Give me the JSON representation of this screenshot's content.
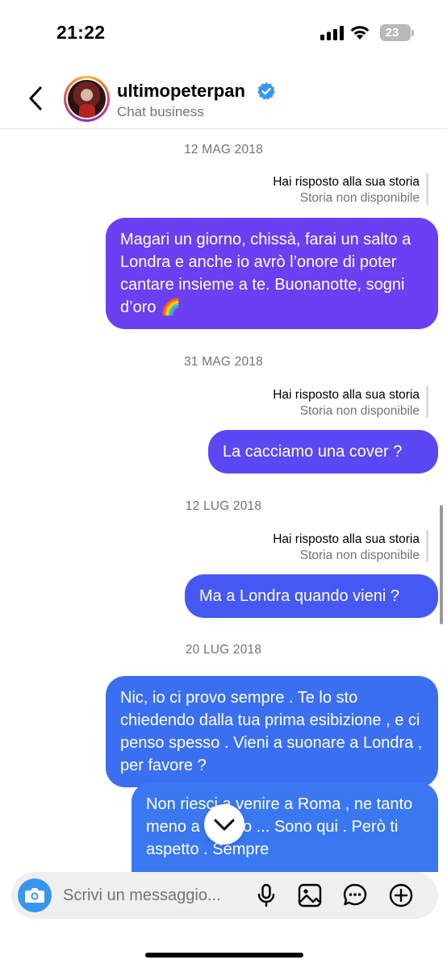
{
  "status_bar": {
    "time": "21:22",
    "battery": "23"
  },
  "header": {
    "username": "ultimopeterpan",
    "subtitle": "Chat business"
  },
  "conversation": {
    "sections": [
      {
        "date": "12 MAG 2018",
        "reply_title": "Hai risposto alla sua storia",
        "reply_status": "Storia non disponibile",
        "messages": [
          "Magari un giorno, chissà, farai un salto a Londra e anche io avrò l’onore di poter cantare insieme a te. Buonanotte, sogni d’oro 🌈"
        ]
      },
      {
        "date": "31 MAG 2018",
        "reply_title": "Hai risposto alla sua storia",
        "reply_status": "Storia non disponibile",
        "messages": [
          "La cacciamo una cover ?"
        ]
      },
      {
        "date": "12 LUG 2018",
        "reply_title": "Hai risposto alla sua storia",
        "reply_status": "Storia non disponibile",
        "messages": [
          "Ma a Londra quando vieni ?"
        ]
      },
      {
        "date": "20 LUG 2018",
        "messages": [
          "Nic, io ci provo sempre . Te lo sto chiedendo dalla tua prima esibizione , e ci penso spesso . Vieni a suonare a Londra , per favore ?",
          "Non riesci a venire a Roma , ne tanto meno a Milano ... Sono qui . Però ti aspetto . Sempre"
        ]
      }
    ]
  },
  "composer": {
    "placeholder": "Scrivi un messaggio..."
  },
  "colors": {
    "bubble_1": "#6b3ff2",
    "bubble_2": "#5a48f3",
    "bubble_3": "#4558f4",
    "bubble_4": "#3b6ff2",
    "bubble_5": "#3a78f2",
    "camera": "#3797f0",
    "verified": "#3797f0"
  },
  "icons": [
    "back-icon",
    "verified-icon",
    "chevron-down-icon",
    "camera-icon",
    "microphone-icon",
    "image-icon",
    "sticker-icon",
    "plus-circle-icon"
  ]
}
